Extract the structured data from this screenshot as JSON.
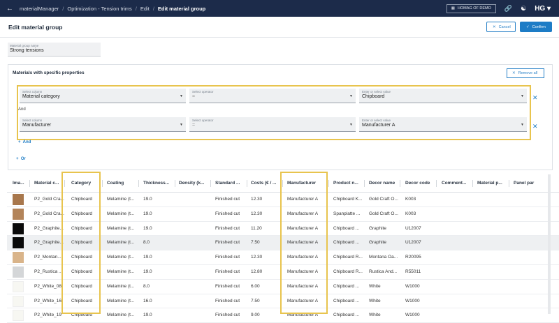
{
  "topbar": {
    "back_icon": "arrow-left-icon",
    "crumbs": [
      "materialManager",
      "Optimization - Tension trims",
      "Edit",
      "Edit material group"
    ],
    "company": "HOMAG OF DEMO",
    "logo": "HG",
    "icons": [
      "link-icon",
      "support-icon",
      "user-menu-icon"
    ]
  },
  "header": {
    "title": "Edit material group",
    "cancel_label": "Cancel",
    "confirm_label": "Confirm"
  },
  "group_name": {
    "label": "Material group name",
    "value": "Strong tensions"
  },
  "materials": {
    "title": "Materials with specific properties",
    "remove_all_label": "Remove all",
    "and_label": "And",
    "add_and_label": "And",
    "add_or_label": "Or",
    "conditions": [
      {
        "column_label": "Select column",
        "column_value": "Material category",
        "operator_label": "Select operator",
        "operator_value": "=",
        "value_label": "Enter or select value",
        "value_value": "Chipboard"
      },
      {
        "column_label": "Select column",
        "column_value": "Manufacturer",
        "operator_label": "Select operator",
        "operator_value": "=",
        "value_label": "Enter or select value",
        "value_value": "Manufacturer A"
      }
    ]
  },
  "table": {
    "headers": [
      "Ima...",
      "Material c...",
      "Category",
      "Coating",
      "Thickness...",
      "Density (k...",
      "Standard ...",
      "Costs (€ / ...",
      "Manufacturer",
      "Product n...",
      "Decor name",
      "Decor code",
      "Comment...",
      "Material p...",
      "Panel par"
    ],
    "rows": [
      {
        "color": "#a8774c",
        "material": "P2_Gold Cra...",
        "category": "Chipboard",
        "coating": "Melamine (t...",
        "thickness": "19.0",
        "standard": "Finished cut",
        "costs": "12.30",
        "manufacturer": "Manufacturer A",
        "product": "Chipboard K...",
        "decor_name": "Gold Craft O...",
        "decor_code": "K003"
      },
      {
        "color": "#b3845a",
        "material": "P2_Gold Cra...",
        "category": "Chipboard",
        "coating": "Melamine (t...",
        "thickness": "19.0",
        "standard": "Finished cut",
        "costs": "12.30",
        "manufacturer": "Manufacturer A",
        "product": "Spanplatte ...",
        "decor_name": "Gold Craft O...",
        "decor_code": "K003"
      },
      {
        "color": "#0a0a0a",
        "material": "P2_Graphite...",
        "category": "Chipboard",
        "coating": "Melamine (t...",
        "thickness": "19.0",
        "standard": "Finished cut",
        "costs": "11.20",
        "manufacturer": "Manufacturer A",
        "product": "Chipboard ...",
        "decor_name": "Graphite",
        "decor_code": "U12007"
      },
      {
        "color": "#0a0a0a",
        "material": "P2_Graphite...",
        "category": "Chipboard",
        "coating": "Melamine (t...",
        "thickness": "8.0",
        "standard": "Finished cut",
        "costs": "7.50",
        "manufacturer": "Manufacturer A",
        "product": "Chipboard ...",
        "decor_name": "Graphite",
        "decor_code": "U12007"
      },
      {
        "color": "#d9b48a",
        "material": "P2_Montan...",
        "category": "Chipboard",
        "coating": "Melamine (t...",
        "thickness": "19.0",
        "standard": "Finished cut",
        "costs": "12.30",
        "manufacturer": "Manufacturer A",
        "product": "Chipboard R...",
        "decor_name": "Montana Oa...",
        "decor_code": "R20095"
      },
      {
        "color": "#d4d6d8",
        "material": "P2_Rustica ...",
        "category": "Chipboard",
        "coating": "Melamine (t...",
        "thickness": "19.0",
        "standard": "Finished cut",
        "costs": "12.80",
        "manufacturer": "Manufacturer A",
        "product": "Chipboard R...",
        "decor_name": "Rustica And...",
        "decor_code": "R55011"
      },
      {
        "color": "#f7f7f2",
        "material": "P2_White_08",
        "category": "Chipboard",
        "coating": "Melamine (t...",
        "thickness": "8.0",
        "standard": "Finished cut",
        "costs": "6.00",
        "manufacturer": "Manufacturer A",
        "product": "Chipboard ...",
        "decor_name": "White",
        "decor_code": "W1000"
      },
      {
        "color": "#f7f7f2",
        "material": "P2_White_16",
        "category": "Chipboard",
        "coating": "Melamine (t...",
        "thickness": "16.0",
        "standard": "Finished cut",
        "costs": "7.50",
        "manufacturer": "Manufacturer A",
        "product": "Chipboard ...",
        "decor_name": "White",
        "decor_code": "W1000"
      },
      {
        "color": "#f7f7f2",
        "material": "P2_White_19",
        "category": "Chipboard",
        "coating": "Melamine (t...",
        "thickness": "19.0",
        "standard": "Finished cut",
        "costs": "9.00",
        "manufacturer": "Manufacturer A",
        "product": "Chipboard ...",
        "decor_name": "White",
        "decor_code": "W1000"
      }
    ]
  },
  "colors": {
    "topbar": "#1c2b4a",
    "accent": "#1d7cc6",
    "highlight": "#e8c44e"
  }
}
